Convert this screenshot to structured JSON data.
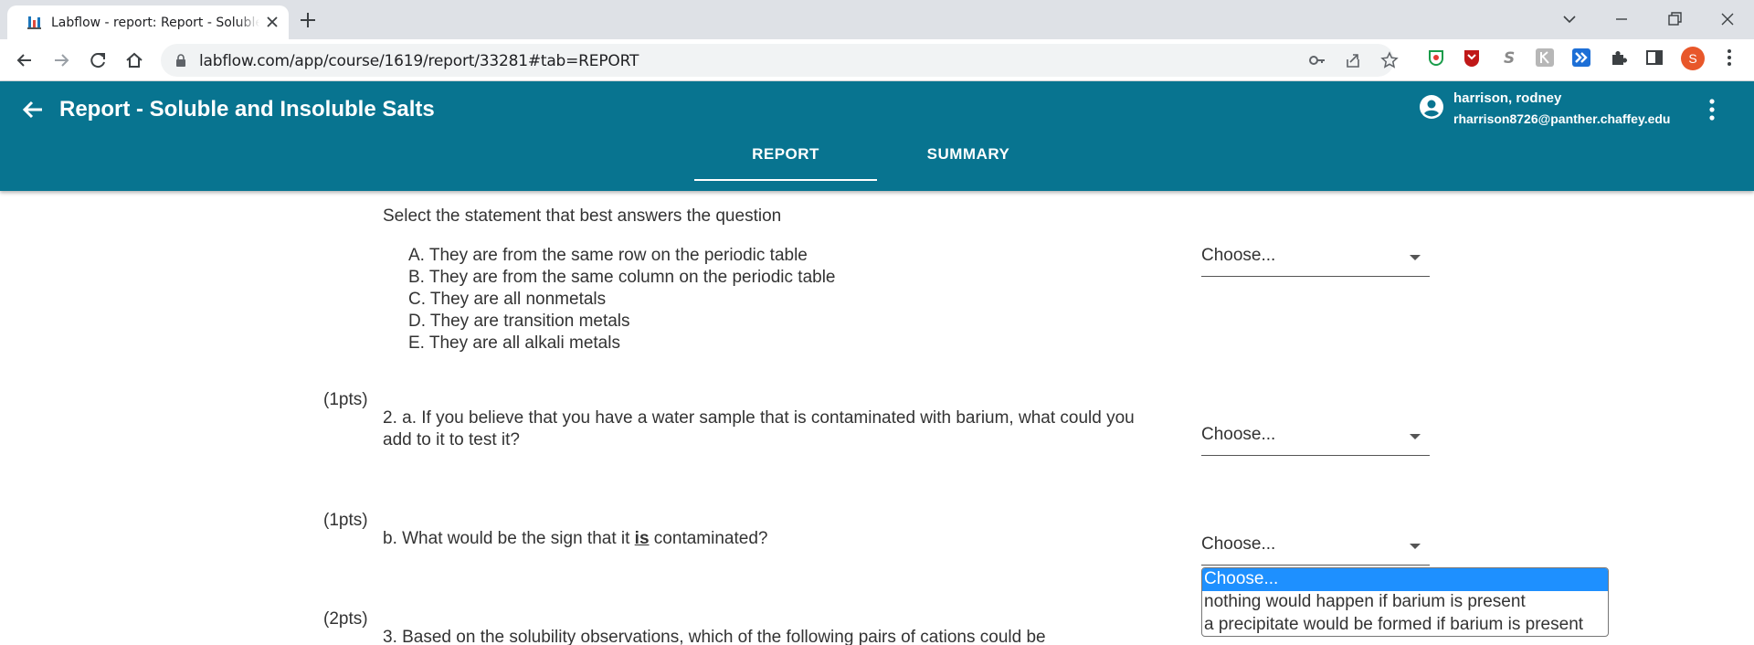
{
  "browser": {
    "tab_title": "Labflow - report: Report - Soluble",
    "url": "labflow.com/app/course/1619/report/33281#tab=REPORT",
    "profile_initial": "S"
  },
  "header": {
    "title": "Report - Soluble and Insoluble Salts",
    "user_name": "harrison, rodney",
    "user_email": "rharrison8726@panther.chaffey.edu",
    "tabs": [
      {
        "label": "REPORT"
      },
      {
        "label": "SUMMARY"
      }
    ],
    "bg_color": "#087490"
  },
  "content": {
    "q1": {
      "prompt": "Select the statement that best answers the question",
      "options": [
        "A. They are from the same row on the periodic table",
        "B. They are from the same column on the periodic table",
        "C. They are all nonmetals",
        "D. They are transition metals",
        "E. They are all alkali metals"
      ],
      "select_value": "Choose..."
    },
    "q2a": {
      "points": "(1pts)",
      "line1": "2. a. If you believe that you have a water sample that is contaminated with barium, what could you",
      "line2": "add to it to test it?",
      "select_value": "Choose..."
    },
    "q2b": {
      "points": "(1pts)",
      "text_before": "b. What would be the sign that it ",
      "text_emph": "is",
      "text_after": " contaminated?",
      "select_value": "Choose...",
      "dropdown_options": [
        "Choose...",
        "nothing would happen if barium is present",
        "a precipitate would be formed if barium is present"
      ]
    },
    "q3": {
      "points": "(2pts)",
      "line1": "3. Based on the solubility observations, which of the following pairs of cations could be"
    }
  }
}
